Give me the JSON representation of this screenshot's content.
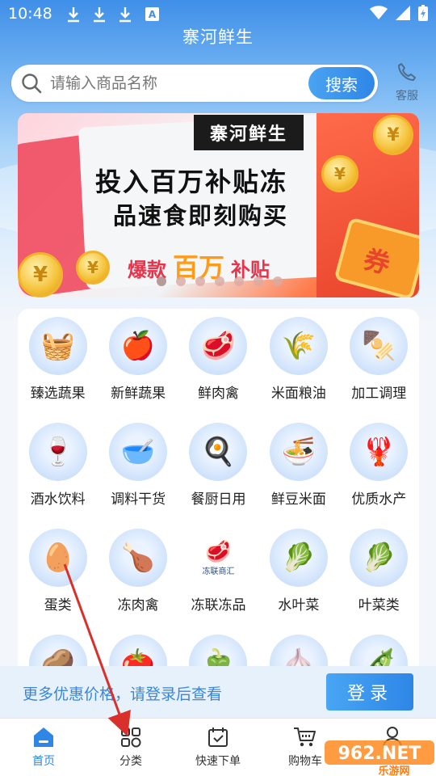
{
  "status_bar": {
    "time": "10:48"
  },
  "app_title": "寨河鲜生",
  "search": {
    "placeholder": "请输入商品名称",
    "button": "搜索"
  },
  "service": {
    "label": "客服"
  },
  "banner": {
    "brand": "寨河鲜生",
    "line1": "投入百万补贴冻",
    "line2": "品速食即刻购买",
    "hot_left": "爆款",
    "hot_big": "百万",
    "hot_right": "补贴",
    "coupon_char": "券",
    "slides": 7,
    "active_slide": 0
  },
  "categories": [
    {
      "label": "臻选蔬果",
      "icon": "🧺"
    },
    {
      "label": "新鲜蔬果",
      "icon": "🍎"
    },
    {
      "label": "鲜肉禽",
      "icon": "🥩"
    },
    {
      "label": "米面粮油",
      "icon": "🌾"
    },
    {
      "label": "加工调理",
      "icon": "🍢"
    },
    {
      "label": "酒水饮料",
      "icon": "🍷"
    },
    {
      "label": "调料干货",
      "icon": "🥣"
    },
    {
      "label": "餐厨日用",
      "icon": "🍳"
    },
    {
      "label": "鲜豆米面",
      "icon": "🍜"
    },
    {
      "label": "优质水产",
      "icon": "🦞"
    },
    {
      "label": "蛋类",
      "icon": "🥚"
    },
    {
      "label": "冻肉禽",
      "icon": "🍗"
    },
    {
      "label": "冻联冻品",
      "icon": "🥩",
      "subtext": "冻联商汇"
    },
    {
      "label": "水叶菜",
      "icon": "🥬"
    },
    {
      "label": "叶菜类",
      "icon": "🥬"
    },
    {
      "label": "",
      "icon": "🥔"
    },
    {
      "label": "",
      "icon": "🍅"
    },
    {
      "label": "",
      "icon": "🫑"
    },
    {
      "label": "",
      "icon": "🧄"
    },
    {
      "label": "",
      "icon": "🫛"
    }
  ],
  "login_bar": {
    "hint": "更多优惠价格，请登录后查看",
    "button": "登录"
  },
  "bottom_nav": [
    {
      "label": "首页",
      "icon": "home-icon",
      "active": true
    },
    {
      "label": "分类",
      "icon": "category-icon",
      "active": false
    },
    {
      "label": "快速下单",
      "icon": "quick-order-icon",
      "active": false
    },
    {
      "label": "购物车",
      "icon": "cart-icon",
      "active": false
    },
    {
      "label": "",
      "icon": "user-icon",
      "active": false
    }
  ],
  "watermark": {
    "text": "962.NET",
    "subtext": "乐游网"
  },
  "colors": {
    "accent": "#2e86e6",
    "header": "#3f8fe8",
    "annotation_arrow": "#d9302b"
  }
}
